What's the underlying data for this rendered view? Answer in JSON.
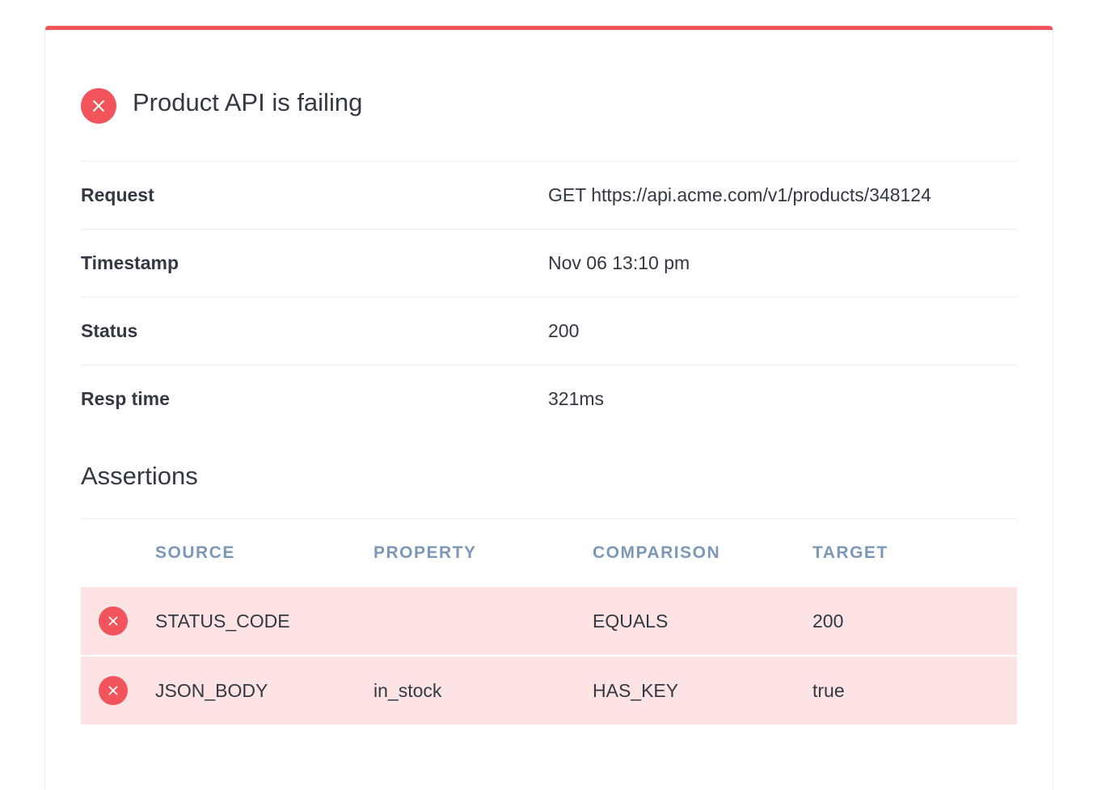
{
  "colors": {
    "accent_red": "#f2545b",
    "failure_row_bg": "#fde3e4",
    "header_text": "#7c98b6",
    "body_text": "#333842"
  },
  "header": {
    "icon": "error-x-icon",
    "title": "Product API is failing"
  },
  "details": [
    {
      "label": "Request",
      "value": "GET https://api.acme.com/v1/products/348124"
    },
    {
      "label": "Timestamp",
      "value": "Nov 06 13:10 pm"
    },
    {
      "label": "Status",
      "value": "200"
    },
    {
      "label": "Resp time",
      "value": "321ms"
    }
  ],
  "assertions": {
    "title": "Assertions",
    "columns": {
      "source": "SOURCE",
      "property": "PROPERTY",
      "comparison": "COMPARISON",
      "target": "TARGET"
    },
    "rows": [
      {
        "status_icon": "error-x-icon",
        "source": "STATUS_CODE",
        "property": "",
        "comparison": "EQUALS",
        "target": "200"
      },
      {
        "status_icon": "error-x-icon",
        "source": "JSON_BODY",
        "property": "in_stock",
        "comparison": "HAS_KEY",
        "target": "true"
      }
    ]
  }
}
